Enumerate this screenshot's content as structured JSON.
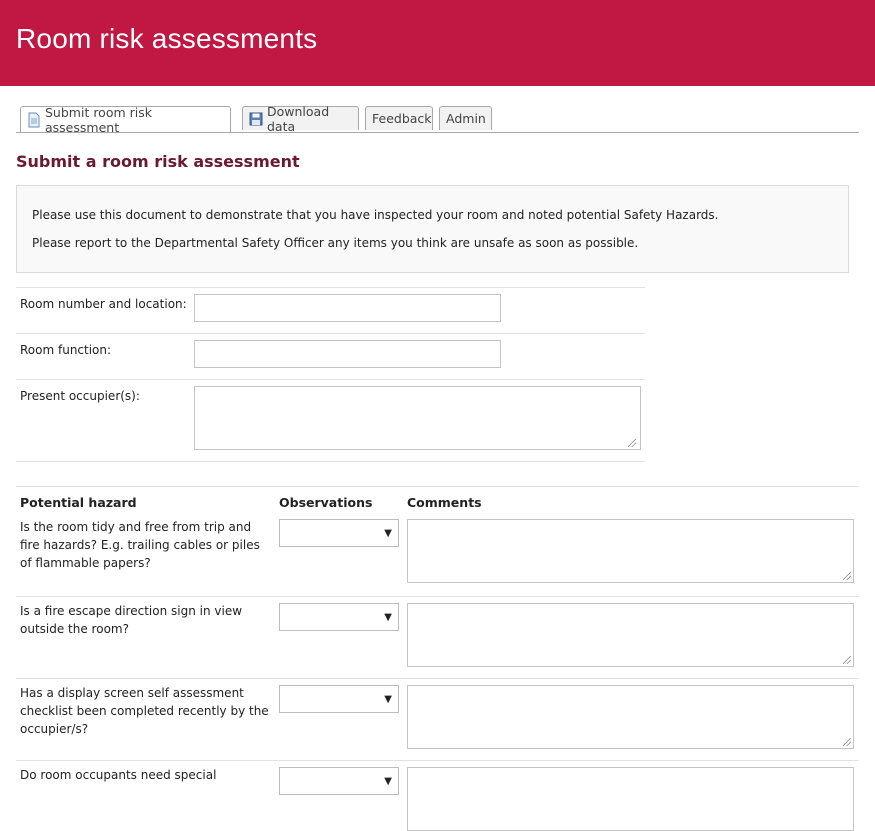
{
  "header": {
    "title": "Room risk assessments"
  },
  "tabs": [
    {
      "label": "Submit room risk assessment",
      "icon": "document-icon",
      "active": true
    },
    {
      "label": "Download data",
      "icon": "save-icon",
      "active": false
    },
    {
      "label": "Feedback",
      "active": false
    },
    {
      "label": "Admin",
      "active": false
    }
  ],
  "page_title": "Submit a room risk assessment",
  "intro": {
    "line1": "Please use this document to demonstrate that you have inspected your room and noted potential Safety Hazards.",
    "line2": "Please report to the Departmental Safety Officer any items you think are unsafe as soon as possible."
  },
  "fields": {
    "room_number_label": "Room number and location:",
    "room_number_value": "",
    "room_function_label": "Room function:",
    "room_function_value": "",
    "occupiers_label": "Present occupier(s):",
    "occupiers_value": ""
  },
  "hazard_table": {
    "headers": {
      "hazard": "Potential hazard",
      "observations": "Observations",
      "comments": "Comments"
    },
    "rows": [
      {
        "question": "Is the room tidy and free from trip and fire hazards? E.g. trailing cables or piles of flammable papers?",
        "observation": "",
        "comment": ""
      },
      {
        "question": "Is a fire escape direction sign in view outside the room?",
        "observation": "",
        "comment": ""
      },
      {
        "question": "Has a display screen self assessment checklist been completed recently by the occupier/s?",
        "observation": "",
        "comment": ""
      },
      {
        "question": "Do room occupants need special",
        "observation": "",
        "comment": ""
      }
    ]
  },
  "colors": {
    "header_bg": "#c01843",
    "title_color": "#6b1930"
  }
}
